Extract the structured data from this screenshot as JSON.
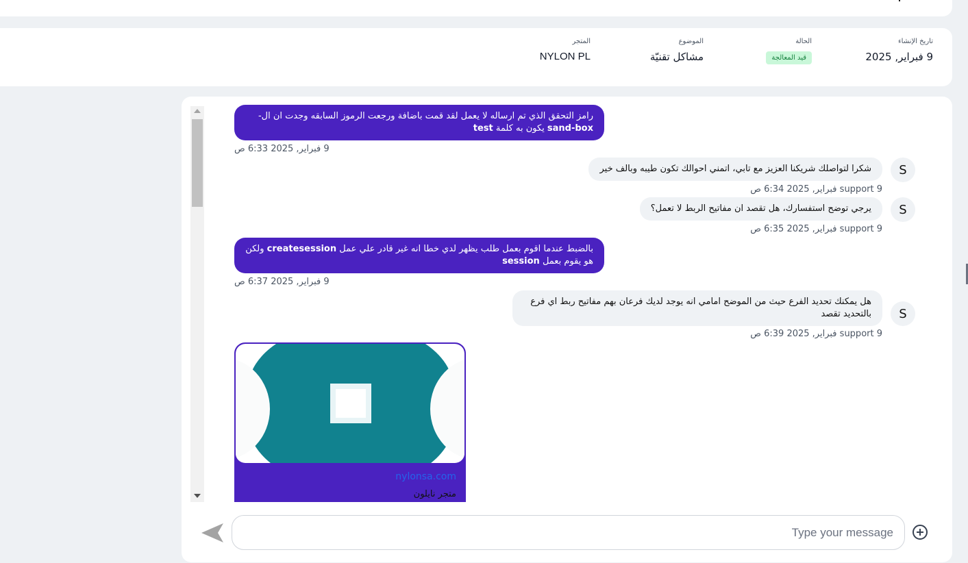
{
  "ticket": {
    "created_label": "تاريخ الإنشاء",
    "created_value": "9 فبراير, 2025",
    "status_label": "الحالة",
    "status_value": "قيد المعالجة",
    "subject_label": "الموضوع",
    "subject_value": "مشاكل تقنيّة",
    "store_label": "المتجر",
    "store_value": "NYLON PL"
  },
  "messages": [
    {
      "sender": "me",
      "text_before": "رامز التحقق الذي تم ارساله لا يعمل لقد قمت باضافة ورجعت الرموز السابقه وجدت ان ال-",
      "bold1": "sand-box",
      "text_middle": " يكون به كلمة ",
      "bold2": "test",
      "time": "9 فبراير, 2025 6:33 ص"
    },
    {
      "sender": "support",
      "avatar": "S",
      "text": "شكرا لتواصلك شريكنا العزيز مع تابي، اتمني احوالك تكون طيبه وبالف خير",
      "meta": "support 9 فبراير, 2025 6:34 ص"
    },
    {
      "sender": "support",
      "avatar": "S",
      "text": "يرجي توضح استفسارك، هل تقصد ان مفاتيح الربط لا تعمل؟",
      "meta": "support 9 فبراير, 2025 6:35 ص"
    },
    {
      "sender": "me",
      "text_before": "بالضبط عندما اقوم بعمل طلب يظهر لدي خطا انه غير قادر علي عمل ",
      "bold1": "createsession",
      "text_middle": " ولكن هو يقوم بعمل ",
      "bold2": "session",
      "time": "9 فبراير, 2025 6:37 ص"
    },
    {
      "sender": "support",
      "avatar": "S",
      "text": "هل يمكنك تحديد الفرع حيث من الموضح امامي انه يوجد لديك فرعان بهم مفاتيح ربط اي فرع بالتحديد تقصد",
      "meta": "support 9 فبراير, 2025 6:39 ص"
    }
  ],
  "link_preview": {
    "url": "nylonsa.com",
    "title": "متجر نايلون"
  },
  "composer": {
    "placeholder": "Type your message"
  },
  "icons": {
    "send": "send-icon",
    "add": "add-circle-icon"
  },
  "colors": {
    "outgoing_bubble": "#4a22c0",
    "incoming_bubble": "#eff2f5",
    "status_badge_bg": "#c9f7d9",
    "status_badge_text": "#15803d",
    "link": "#2563eb"
  }
}
